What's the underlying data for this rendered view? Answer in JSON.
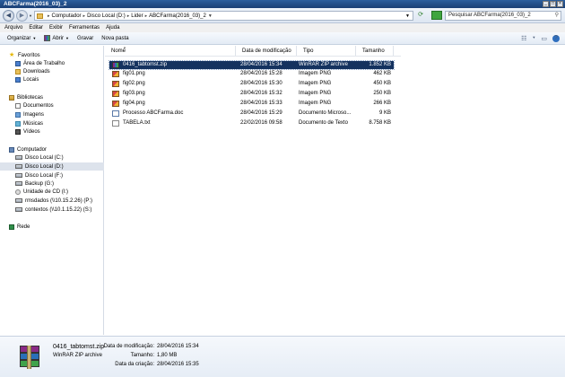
{
  "window": {
    "title": "ABCFarma(2016_03)_2",
    "controls": [
      "_",
      "□",
      "×"
    ]
  },
  "address": {
    "crumbs": [
      "Computador",
      "Disco Local (D:)",
      "Lider",
      "ABCFarma(2016_03)_2"
    ],
    "search_placeholder": "Pesquisar ABCFarma(2016_03)_2"
  },
  "menu": [
    "Arquivo",
    "Editar",
    "Exibir",
    "Ferramentas",
    "Ajuda"
  ],
  "toolbar": {
    "organize": "Organizar",
    "open": "Abrir",
    "burn": "Gravar",
    "new_folder": "Nova pasta"
  },
  "nav": {
    "favorites": {
      "label": "Favoritos",
      "items": [
        "Área de Trabalho",
        "Downloads",
        "Locais"
      ]
    },
    "libraries": {
      "label": "Bibliotecas",
      "items": [
        "Documentos",
        "Imagens",
        "Músicas",
        "Vídeos"
      ]
    },
    "computer": {
      "label": "Computador",
      "items": [
        "Disco Local (C:)",
        "Disco Local (D:)",
        "Disco Local (F:)",
        "Backup (G:)",
        "Unidade de CD (I:)",
        "rmsdados (\\\\10.15.2.26) (P:)",
        "contextos (\\\\10.1.15.22) (S:)"
      ],
      "selected_index": 1
    },
    "network": {
      "label": "Rede"
    }
  },
  "columns": {
    "name": "Nome",
    "modified": "Data de modificação",
    "type": "Tipo",
    "size": "Tamanho"
  },
  "files": [
    {
      "name": "0416_tabtomst.zip",
      "modified": "28/04/2016 15:34",
      "type": "WinRAR ZIP archive",
      "size": "1.852 KB",
      "icon": "zip-icon",
      "selected": true
    },
    {
      "name": "fig01.png",
      "modified": "28/04/2016 15:28",
      "type": "Imagem PNG",
      "size": "462 KB",
      "icon": "png-icon"
    },
    {
      "name": "fig02.png",
      "modified": "28/04/2016 15:30",
      "type": "Imagem PNG",
      "size": "450 KB",
      "icon": "png-icon"
    },
    {
      "name": "fig03.png",
      "modified": "28/04/2016 15:32",
      "type": "Imagem PNG",
      "size": "250 KB",
      "icon": "png-icon"
    },
    {
      "name": "fig04.png",
      "modified": "28/04/2016 15:33",
      "type": "Imagem PNG",
      "size": "266 KB",
      "icon": "png-icon"
    },
    {
      "name": "Processo ABCFarma.doc",
      "modified": "28/04/2016 15:29",
      "type": "Documento Microso...",
      "size": "9 KB",
      "icon": "doc-icon"
    },
    {
      "name": "TABELA.txt",
      "modified": "22/02/2016 09:58",
      "type": "Documento de Texto",
      "size": "8.758 KB",
      "icon": "txt-icon"
    }
  ],
  "details": {
    "name": "0416_tabtomst.zip",
    "type": "WinRAR ZIP archive",
    "modified_label": "Data de modificação:",
    "modified_value": "28/04/2016 15:34",
    "size_label": "Tamanho:",
    "size_value": "1,80 MB",
    "created_label": "Data da criação:",
    "created_value": "28/04/2016 15:35"
  }
}
